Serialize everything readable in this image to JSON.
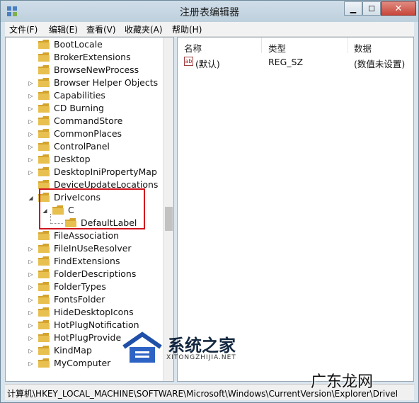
{
  "window": {
    "title": "注册表编辑器"
  },
  "window_buttons": {
    "min": "▁",
    "max": "☐",
    "close": "✕"
  },
  "menu": [
    {
      "label": "文件(F)"
    },
    {
      "label": "编辑(E)"
    },
    {
      "label": "查看(V)"
    },
    {
      "label": "收藏夹(A)"
    },
    {
      "label": "帮助(H)"
    }
  ],
  "tree": {
    "items": [
      {
        "label": "BootLocale",
        "level": 1,
        "expander": ""
      },
      {
        "label": "BrokerExtensions",
        "level": 1,
        "expander": ""
      },
      {
        "label": "BrowseNewProcess",
        "level": 1,
        "expander": ""
      },
      {
        "label": "Browser Helper Objects",
        "level": 1,
        "expander": "▷"
      },
      {
        "label": "Capabilities",
        "level": 1,
        "expander": "▷"
      },
      {
        "label": "CD Burning",
        "level": 1,
        "expander": "▷"
      },
      {
        "label": "CommandStore",
        "level": 1,
        "expander": "▷"
      },
      {
        "label": "CommonPlaces",
        "level": 1,
        "expander": "▷"
      },
      {
        "label": "ControlPanel",
        "level": 1,
        "expander": "▷"
      },
      {
        "label": "Desktop",
        "level": 1,
        "expander": "▷"
      },
      {
        "label": "DesktopIniPropertyMap",
        "level": 1,
        "expander": "▷"
      },
      {
        "label": "DeviceUpdateLocations",
        "level": 1,
        "expander": ""
      },
      {
        "label": "DriveIcons",
        "level": 1,
        "expander": "◢"
      },
      {
        "label": "C",
        "level": 2,
        "expander": "◢"
      },
      {
        "label": "DefaultLabel",
        "level": 3,
        "expander": ""
      },
      {
        "label": "FileAssociation",
        "level": 1,
        "expander": ""
      },
      {
        "label": "FileInUseResolver",
        "level": 1,
        "expander": "▷"
      },
      {
        "label": "FindExtensions",
        "level": 1,
        "expander": "▷"
      },
      {
        "label": "FolderDescriptions",
        "level": 1,
        "expander": "▷"
      },
      {
        "label": "FolderTypes",
        "level": 1,
        "expander": "▷"
      },
      {
        "label": "FontsFolder",
        "level": 1,
        "expander": "▷"
      },
      {
        "label": "HideDesktopIcons",
        "level": 1,
        "expander": "▷"
      },
      {
        "label": "HotPlugNotification",
        "level": 1,
        "expander": "▷"
      },
      {
        "label": "HotPlugProvide",
        "level": 1,
        "expander": "▷"
      },
      {
        "label": "KindMap",
        "level": 1,
        "expander": "▷"
      },
      {
        "label": "MyComputer",
        "level": 1,
        "expander": "▷"
      }
    ]
  },
  "values": {
    "columns": [
      "名称",
      "类型",
      "数据"
    ],
    "rows": [
      {
        "name": "(默认)",
        "type": "REG_SZ",
        "data": "(数值未设置)"
      }
    ],
    "ab_icon": "ab"
  },
  "statusbar": {
    "path": "计算机\\HKEY_LOCAL_MACHINE\\SOFTWARE\\Microsoft\\Windows\\CurrentVersion\\Explorer\\DriveI"
  },
  "watermark": {
    "brand": "系统之家",
    "site": "XITONGZHIJIA.NET",
    "corner": "广东龙网"
  },
  "colors": {
    "highlight_box": "#d0141e",
    "folder": "#e8c050"
  }
}
